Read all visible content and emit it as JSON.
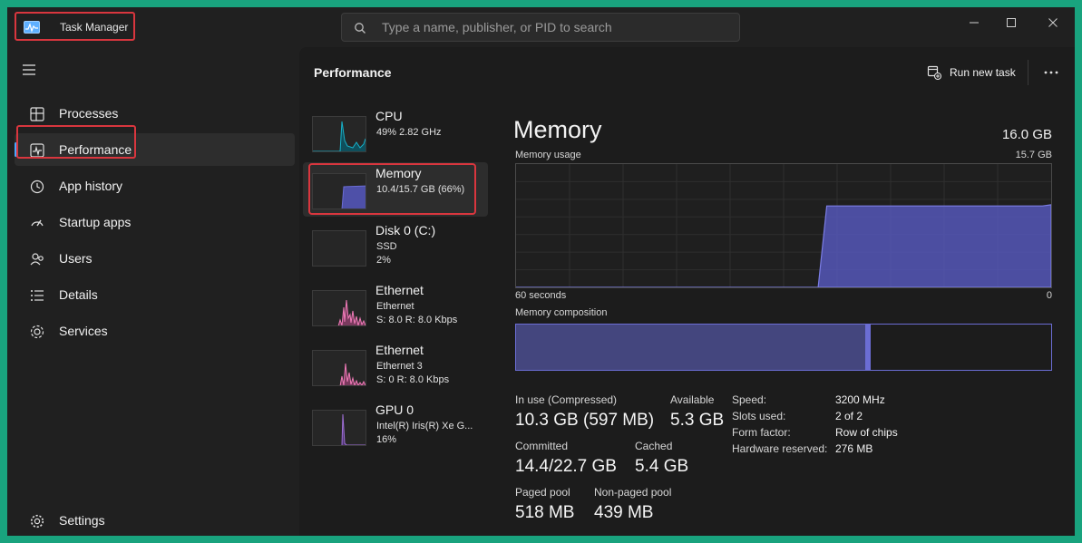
{
  "app": {
    "title": "Task Manager"
  },
  "search": {
    "placeholder": "Type a name, publisher, or PID to search"
  },
  "window_controls": {
    "minimize": "—",
    "maximize": "☐",
    "close": "✕"
  },
  "sidebar": {
    "items": [
      {
        "label": "Processes",
        "icon": "processes-icon"
      },
      {
        "label": "Performance",
        "icon": "performance-icon",
        "active": true
      },
      {
        "label": "App history",
        "icon": "app-history-icon"
      },
      {
        "label": "Startup apps",
        "icon": "startup-apps-icon"
      },
      {
        "label": "Users",
        "icon": "users-icon"
      },
      {
        "label": "Details",
        "icon": "details-icon"
      },
      {
        "label": "Services",
        "icon": "services-icon"
      }
    ],
    "settings_label": "Settings"
  },
  "header": {
    "title": "Performance",
    "run_new_task": "Run new task"
  },
  "resources": [
    {
      "name": "CPU",
      "line1": "49% 2.82 GHz",
      "line2": "",
      "color": "#17b1c9"
    },
    {
      "name": "Memory",
      "line1": "10.4/15.7 GB (66%)",
      "line2": "",
      "color": "#6b6dd4",
      "active": true
    },
    {
      "name": "Disk 0 (C:)",
      "line1": "SSD",
      "line2": "2%",
      "color": "#3fb34f"
    },
    {
      "name": "Ethernet",
      "line1": "Ethernet",
      "line2": "S: 8.0  R: 8.0 Kbps",
      "color": "#f07ab8"
    },
    {
      "name": "Ethernet",
      "line1": "Ethernet 3",
      "line2": "S: 0  R: 8.0 Kbps",
      "color": "#f07ab8"
    },
    {
      "name": "GPU 0",
      "line1": "Intel(R) Iris(R) Xe G...",
      "line2": "16%",
      "color": "#a070d8"
    }
  ],
  "memory": {
    "title": "Memory",
    "total": "16.0 GB",
    "usage_label": "Memory usage",
    "usage_max": "15.7 GB",
    "time_left": "60 seconds",
    "time_right": "0",
    "composition_label": "Memory composition",
    "composition": {
      "in_use_fraction": 0.655,
      "modified_fraction": 0.008
    },
    "usage_series_percent": [
      0,
      0,
      0,
      0,
      0,
      0,
      0,
      0,
      0,
      0,
      0,
      0,
      0,
      0,
      0,
      0,
      0,
      0,
      0,
      0,
      0,
      0,
      0,
      0,
      0,
      0,
      0,
      0,
      0,
      0,
      0,
      0,
      0,
      0,
      0,
      0,
      66,
      66,
      66,
      66,
      66,
      66,
      66,
      66,
      66,
      66,
      66,
      66,
      66,
      66,
      66,
      66,
      66,
      66,
      66,
      66,
      66,
      66,
      66,
      66,
      66,
      66,
      67
    ],
    "stats": {
      "in_use_label": "In use (Compressed)",
      "in_use_value": "10.3 GB (597 MB)",
      "available_label": "Available",
      "available_value": "5.3 GB",
      "committed_label": "Committed",
      "committed_value": "14.4/22.7 GB",
      "cached_label": "Cached",
      "cached_value": "5.4 GB",
      "paged_label": "Paged pool",
      "paged_value": "518 MB",
      "nonpaged_label": "Non-paged pool",
      "nonpaged_value": "439 MB"
    },
    "specs": [
      {
        "key": "Speed:",
        "value": "3200 MHz"
      },
      {
        "key": "Slots used:",
        "value": "2 of 2"
      },
      {
        "key": "Form factor:",
        "value": "Row of chips"
      },
      {
        "key": "Hardware reserved:",
        "value": "276 MB"
      }
    ]
  },
  "colors": {
    "accent": "#4aa7ff",
    "highlight": "#d9363e",
    "memory": "#6b6dd4",
    "frame": "#19a37e"
  }
}
